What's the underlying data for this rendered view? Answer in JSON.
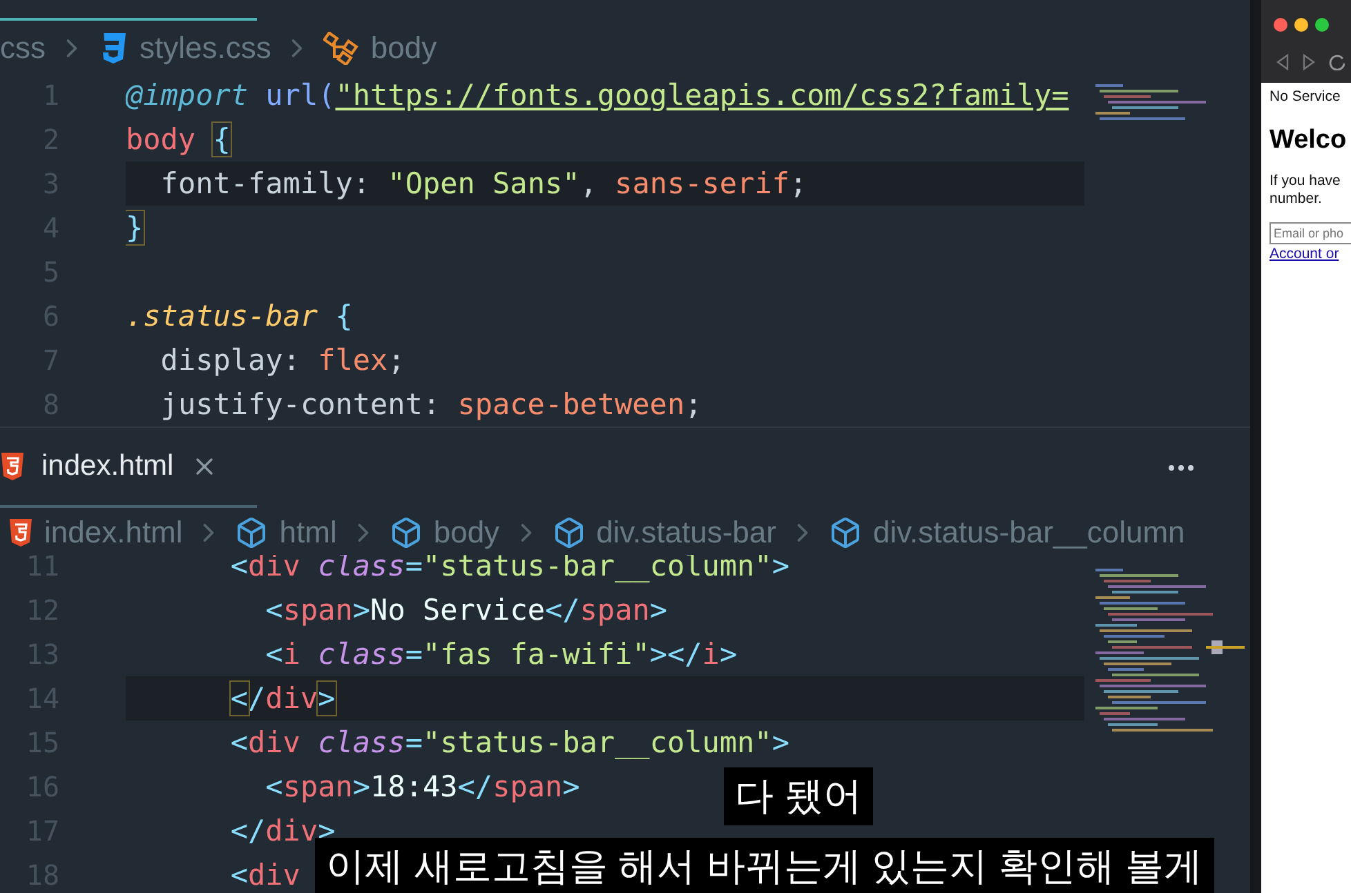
{
  "top_editor": {
    "breadcrumb": [
      {
        "kind": "folder",
        "label": "css"
      },
      {
        "kind": "css-file",
        "label": "styles.css"
      },
      {
        "kind": "symbol",
        "label": "body"
      }
    ],
    "lines": [
      {
        "number": "1",
        "highlighted": false,
        "tokens": [
          {
            "text": "@import ",
            "kind": "at"
          },
          {
            "text": "url(",
            "kind": "fn"
          },
          {
            "text": "\"https://fonts.googleapis.com/css2?family=",
            "kind": "link"
          }
        ]
      },
      {
        "number": "2",
        "highlighted": false,
        "tokens": [
          {
            "text": "body ",
            "kind": "sel"
          },
          {
            "text": "{",
            "kind": "match"
          }
        ]
      },
      {
        "number": "3",
        "highlighted": true,
        "tokens": [
          {
            "text": "  font-family: ",
            "kind": "prop"
          },
          {
            "text": "\"Open Sans\"",
            "kind": "str"
          },
          {
            "text": ", ",
            "kind": "prop"
          },
          {
            "text": "sans-serif",
            "kind": "val"
          },
          {
            "text": ";",
            "kind": "prop"
          }
        ]
      },
      {
        "number": "4",
        "highlighted": false,
        "tokens": [
          {
            "text": "}",
            "kind": "match"
          }
        ]
      },
      {
        "number": "5",
        "highlighted": false
      },
      {
        "number": "6",
        "highlighted": false,
        "tokens": [
          {
            "text": ".status-bar ",
            "kind": "cls"
          },
          {
            "text": "{",
            "kind": "punct"
          }
        ]
      },
      {
        "number": "7",
        "highlighted": false,
        "tokens": [
          {
            "text": "  display: ",
            "kind": "prop"
          },
          {
            "text": "flex",
            "kind": "val"
          },
          {
            "text": ";",
            "kind": "prop"
          }
        ]
      },
      {
        "number": "8",
        "highlighted": false,
        "tokens": [
          {
            "text": "  justify-content: ",
            "kind": "prop"
          },
          {
            "text": "space-between",
            "kind": "val"
          },
          {
            "text": ";",
            "kind": "prop"
          }
        ]
      }
    ]
  },
  "bottom_editor": {
    "tab": {
      "label": "index.html",
      "selected": true
    },
    "breadcrumb": [
      {
        "kind": "html-file",
        "label": "index.html"
      },
      {
        "kind": "element",
        "label": "html"
      },
      {
        "kind": "element",
        "label": "body"
      },
      {
        "kind": "element",
        "label": "div.status-bar"
      },
      {
        "kind": "element",
        "label": "div.status-bar__column"
      }
    ],
    "lines": [
      {
        "number": "11",
        "highlighted": false,
        "tokens": [
          {
            "text": "      <",
            "kind": "punct"
          },
          {
            "text": "div ",
            "kind": "tag"
          },
          {
            "text": "class",
            "kind": "attr"
          },
          {
            "text": "=",
            "kind": "punct"
          },
          {
            "text": "\"status-bar__column\"",
            "kind": "str"
          },
          {
            "text": ">",
            "kind": "punct"
          }
        ]
      },
      {
        "number": "12",
        "highlighted": false,
        "tokens": [
          {
            "text": "        <",
            "kind": "punct"
          },
          {
            "text": "span",
            "kind": "tag"
          },
          {
            "text": ">",
            "kind": "punct"
          },
          {
            "text": "No Service",
            "kind": "text"
          },
          {
            "text": "</",
            "kind": "punct"
          },
          {
            "text": "span",
            "kind": "tag"
          },
          {
            "text": ">",
            "kind": "punct"
          }
        ]
      },
      {
        "number": "13",
        "highlighted": false,
        "tokens": [
          {
            "text": "        <",
            "kind": "punct"
          },
          {
            "text": "i ",
            "kind": "tag"
          },
          {
            "text": "class",
            "kind": "attr"
          },
          {
            "text": "=",
            "kind": "punct"
          },
          {
            "text": "\"fas fa-wifi\"",
            "kind": "str"
          },
          {
            "text": "></",
            "kind": "punct"
          },
          {
            "text": "i",
            "kind": "tag"
          },
          {
            "text": ">",
            "kind": "punct"
          }
        ]
      },
      {
        "number": "14",
        "highlighted": true,
        "tokens": [
          {
            "text": "      <",
            "kind": "match"
          },
          {
            "text": "/",
            "kind": "punct"
          },
          {
            "text": "div",
            "kind": "tag"
          },
          {
            "text": ">",
            "kind": "match"
          }
        ]
      },
      {
        "number": "15",
        "highlighted": false,
        "tokens": [
          {
            "text": "      <",
            "kind": "punct"
          },
          {
            "text": "div ",
            "kind": "tag"
          },
          {
            "text": "class",
            "kind": "attr"
          },
          {
            "text": "=",
            "kind": "punct"
          },
          {
            "text": "\"status-bar__column\"",
            "kind": "str"
          },
          {
            "text": ">",
            "kind": "punct"
          }
        ]
      },
      {
        "number": "16",
        "highlighted": false,
        "tokens": [
          {
            "text": "        <",
            "kind": "punct"
          },
          {
            "text": "span",
            "kind": "tag"
          },
          {
            "text": ">",
            "kind": "punct"
          },
          {
            "text": "18:43",
            "kind": "text"
          },
          {
            "text": "</",
            "kind": "punct"
          },
          {
            "text": "span",
            "kind": "tag"
          },
          {
            "text": ">",
            "kind": "punct"
          }
        ]
      },
      {
        "number": "17",
        "highlighted": false,
        "tokens": [
          {
            "text": "      </",
            "kind": "punct"
          },
          {
            "text": "div",
            "kind": "tag"
          },
          {
            "text": ">",
            "kind": "punct"
          }
        ]
      },
      {
        "number": "18",
        "highlighted": false,
        "tokens": [
          {
            "text": "      <",
            "kind": "punct"
          },
          {
            "text": "div",
            "kind": "tag"
          }
        ]
      }
    ]
  },
  "browser": {
    "status_text": "No Service",
    "heading": "Welco",
    "paragraph_lines": [
      "If you have",
      "number."
    ],
    "input": {
      "placeholder": "Email or pho"
    },
    "link": "Account or"
  },
  "subtitles": [
    "다 됐어",
    "이제 새로고침을 해서 바뀌는게 있는지 확인해 볼게"
  ]
}
